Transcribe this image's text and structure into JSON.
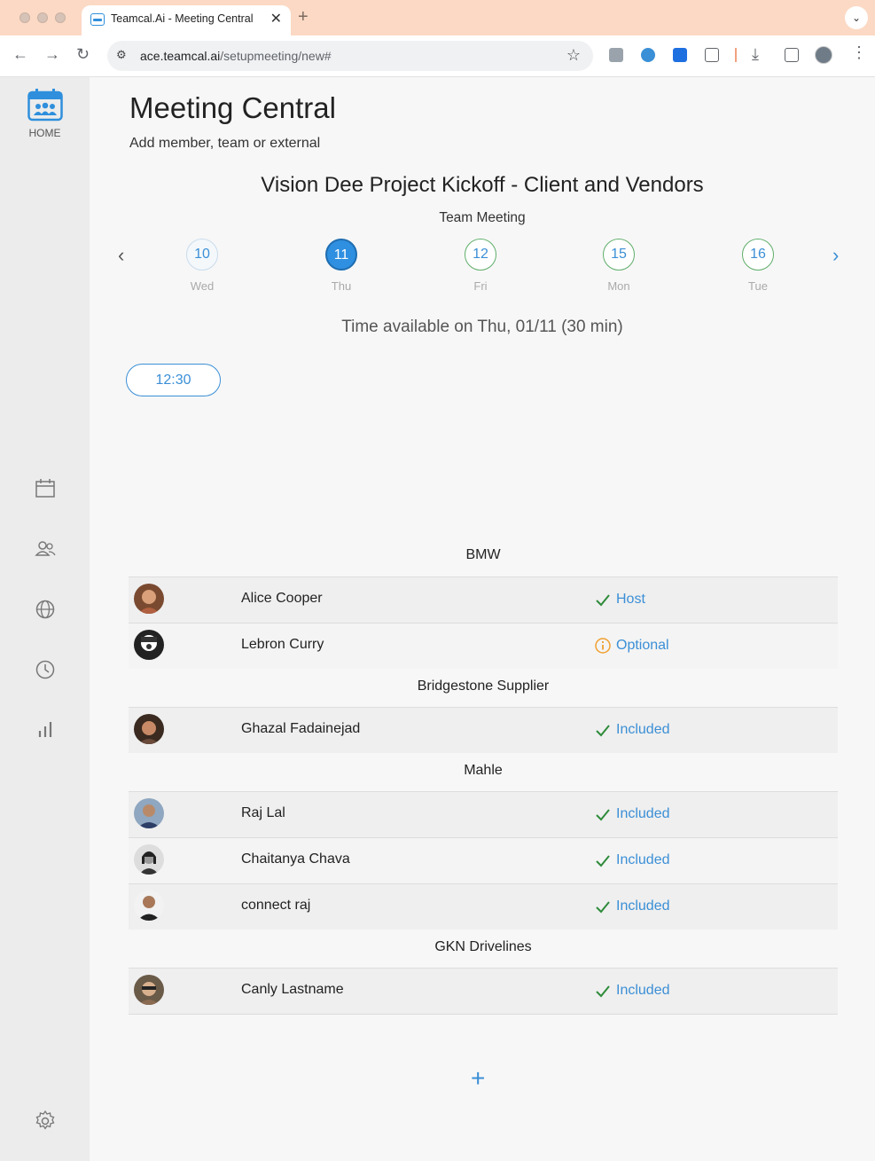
{
  "browser": {
    "tab_title": "Teamcal.Ai - Meeting Central",
    "tab_close": "✕",
    "new_tab": "+",
    "url_host": "ace.teamcal.ai",
    "url_path": "/setupmeeting/new#"
  },
  "sidebar": {
    "home_label": "HOME",
    "icons": [
      "calendar-icon",
      "users-icon",
      "globe-icon",
      "clock-icon",
      "bar-chart-icon",
      "gear-icon"
    ]
  },
  "page": {
    "title": "Meeting Central",
    "subtitle": "Add member, team or external",
    "meeting_title": "Vision Dee Project Kickoff - Client and Vendors",
    "meeting_type": "Team Meeting"
  },
  "dates": [
    {
      "num": "10",
      "day": "Wed",
      "state": "unavailable"
    },
    {
      "num": "11",
      "day": "Thu",
      "state": "selected"
    },
    {
      "num": "12",
      "day": "Fri",
      "state": "available"
    },
    {
      "num": "15",
      "day": "Mon",
      "state": "available"
    },
    {
      "num": "16",
      "day": "Tue",
      "state": "available"
    }
  ],
  "availability": "Time available on Thu, 01/11 (30 min)",
  "time_slot": "12:30",
  "groups": [
    {
      "company": "BMW",
      "members": [
        {
          "name": "Alice Cooper",
          "status": "Host",
          "status_type": "check"
        },
        {
          "name": "Lebron Curry",
          "status": "Optional",
          "status_type": "info"
        }
      ]
    },
    {
      "company": "Bridgestone Supplier",
      "members": [
        {
          "name": "Ghazal Fadainejad",
          "status": "Included",
          "status_type": "check"
        }
      ]
    },
    {
      "company": "Mahle",
      "members": [
        {
          "name": "Raj Lal",
          "status": "Included",
          "status_type": "check"
        },
        {
          "name": "Chaitanya Chava",
          "status": "Included",
          "status_type": "check"
        },
        {
          "name": "connect raj",
          "status": "Included",
          "status_type": "check"
        }
      ]
    },
    {
      "company": "GKN Drivelines",
      "members": [
        {
          "name": "Canly Lastname",
          "status": "Included",
          "status_type": "check"
        }
      ]
    }
  ],
  "add_label": "+",
  "colors": {
    "accent": "#3b8fd6",
    "check": "#2e8b3a",
    "optional": "#f0a030",
    "tab_bar": "#fbd9c4"
  }
}
